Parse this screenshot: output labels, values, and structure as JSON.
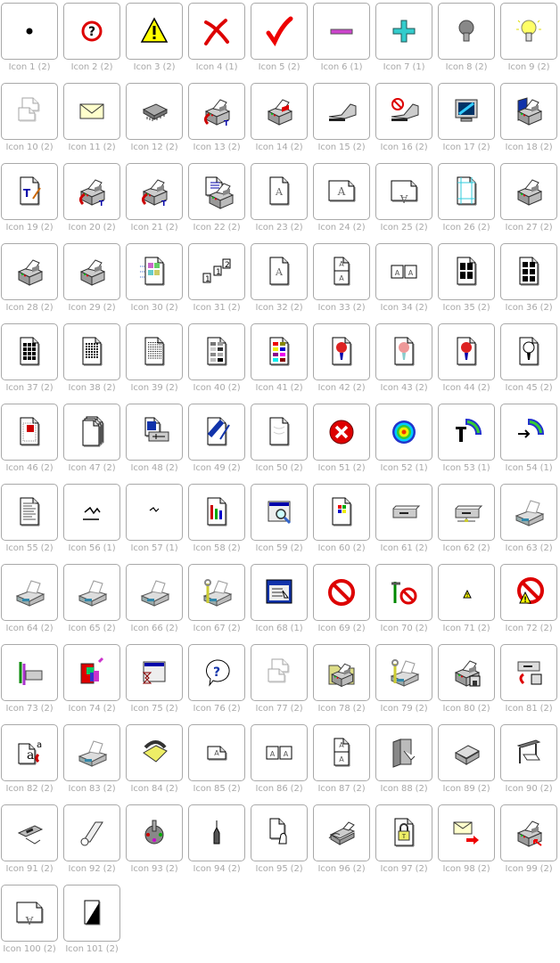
{
  "gallery": {
    "columns": 9,
    "icons": [
      {
        "label": "Icon 1 (2)",
        "name": "dot-icon",
        "glyph": "dot"
      },
      {
        "label": "Icon 2 (2)",
        "name": "question-circle-icon",
        "glyph": "question-red"
      },
      {
        "label": "Icon 3 (2)",
        "name": "warning-icon",
        "glyph": "warning"
      },
      {
        "label": "Icon 4 (1)",
        "name": "red-x-icon",
        "glyph": "redx"
      },
      {
        "label": "Icon 5 (2)",
        "name": "checkmark-icon",
        "glyph": "check"
      },
      {
        "label": "Icon 6 (1)",
        "name": "minus-icon",
        "glyph": "minus"
      },
      {
        "label": "Icon 7 (1)",
        "name": "plus-icon",
        "glyph": "plus"
      },
      {
        "label": "Icon 8 (2)",
        "name": "lightbulb-off-icon",
        "glyph": "bulb-off"
      },
      {
        "label": "Icon 9 (2)",
        "name": "lightbulb-on-icon",
        "glyph": "bulb-on"
      },
      {
        "label": "Icon 10 (2)",
        "name": "page-orientation-icon",
        "glyph": "ghost-doc"
      },
      {
        "label": "Icon 11 (2)",
        "name": "envelope-icon",
        "glyph": "envelope"
      },
      {
        "label": "Icon 12 (2)",
        "name": "memory-chip-icon",
        "glyph": "chip"
      },
      {
        "label": "Icon 13 (2)",
        "name": "printer-font-icon",
        "glyph": "printer-arrow"
      },
      {
        "label": "Icon 14 (2)",
        "name": "printer-cartridge-icon",
        "glyph": "printer-red"
      },
      {
        "label": "Icon 15 (2)",
        "name": "stapler-icon",
        "glyph": "stapler"
      },
      {
        "label": "Icon 16 (2)",
        "name": "stapler-disabled-icon",
        "glyph": "stapler-no"
      },
      {
        "label": "Icon 17 (2)",
        "name": "monitor-icon",
        "glyph": "monitor"
      },
      {
        "label": "Icon 18 (2)",
        "name": "printer-monitor-icon",
        "glyph": "printer-blue"
      },
      {
        "label": "Icon 19 (2)",
        "name": "truetype-edit-icon",
        "glyph": "tt-doc"
      },
      {
        "label": "Icon 20 (2)",
        "name": "printer-truetype-icon",
        "glyph": "printer-arrow"
      },
      {
        "label": "Icon 21 (2)",
        "name": "printer-truetype-outline-icon",
        "glyph": "printer-arrow"
      },
      {
        "label": "Icon 22 (2)",
        "name": "printer-document-icon",
        "glyph": "printer-doc"
      },
      {
        "label": "Icon 23 (2)",
        "name": "portrait-page-icon",
        "glyph": "page-a"
      },
      {
        "label": "Icon 24 (2)",
        "name": "landscape-page-icon",
        "glyph": "page-a-wide"
      },
      {
        "label": "Icon 25 (2)",
        "name": "rotated-page-icon",
        "glyph": "page-a-flip"
      },
      {
        "label": "Icon 26 (2)",
        "name": "page-margins-icon",
        "glyph": "page-margins"
      },
      {
        "label": "Icon 27 (2)",
        "name": "printer-stack-icon",
        "glyph": "printer"
      },
      {
        "label": "Icon 28 (2)",
        "name": "printer-tray-icon",
        "glyph": "printer"
      },
      {
        "label": "Icon 29 (2)",
        "name": "printer-tray-small-icon",
        "glyph": "printer"
      },
      {
        "label": "Icon 30 (2)",
        "name": "color-page-icon",
        "glyph": "page-color"
      },
      {
        "label": "Icon 31 (2)",
        "name": "collate-icon",
        "glyph": "collate"
      },
      {
        "label": "Icon 32 (2)",
        "name": "single-page-icon",
        "glyph": "page-a"
      },
      {
        "label": "Icon 33 (2)",
        "name": "two-pages-vertical-icon",
        "glyph": "pages-vertical"
      },
      {
        "label": "Icon 34 (2)",
        "name": "two-pages-book-icon",
        "glyph": "pages-book"
      },
      {
        "label": "Icon 35 (2)",
        "name": "four-up-page-icon",
        "glyph": "page-grid-4"
      },
      {
        "label": "Icon 36 (2)",
        "name": "six-up-page-icon",
        "glyph": "page-grid-6"
      },
      {
        "label": "Icon 37 (2)",
        "name": "nine-up-page-icon",
        "glyph": "page-grid-9"
      },
      {
        "label": "Icon 38 (2)",
        "name": "fine-dither-page-icon",
        "glyph": "page-grid-dots"
      },
      {
        "label": "Icon 39 (2)",
        "name": "finer-dither-page-icon",
        "glyph": "page-grid-fine"
      },
      {
        "label": "Icon 40 (2)",
        "name": "grayscale-page-icon",
        "glyph": "page-gray"
      },
      {
        "label": "Icon 41 (2)",
        "name": "color-swatches-page-icon",
        "glyph": "page-swatches"
      },
      {
        "label": "Icon 42 (2)",
        "name": "flower-page-icon",
        "glyph": "page-flower"
      },
      {
        "label": "Icon 43 (2)",
        "name": "flower-light-page-icon",
        "glyph": "page-flower-light"
      },
      {
        "label": "Icon 44 (2)",
        "name": "flower-vivid-page-icon",
        "glyph": "page-flower"
      },
      {
        "label": "Icon 45 (2)",
        "name": "flower-bw-page-icon",
        "glyph": "page-flower-bw"
      },
      {
        "label": "Icon 46 (2)",
        "name": "page-resize-icon",
        "glyph": "page-resize"
      },
      {
        "label": "Icon 47 (2)",
        "name": "page-stack-icon",
        "glyph": "page-stack"
      },
      {
        "label": "Icon 48 (2)",
        "name": "page-slider-icon",
        "glyph": "page-slider"
      },
      {
        "label": "Icon 49 (2)",
        "name": "page-pen-icon",
        "glyph": "page-pen"
      },
      {
        "label": "Icon 50 (2)",
        "name": "watermark-page-icon",
        "glyph": "page-blank"
      },
      {
        "label": "Icon 51 (2)",
        "name": "error-circle-icon",
        "glyph": "error"
      },
      {
        "label": "Icon 52 (1)",
        "name": "target-spectrum-icon",
        "glyph": "target"
      },
      {
        "label": "Icon 53 (1)",
        "name": "spectrum-tool-icon",
        "glyph": "spectrum-t"
      },
      {
        "label": "Icon 54 (1)",
        "name": "spectrum-arrow-icon",
        "glyph": "spectrum-arrow"
      },
      {
        "label": "Icon 55 (2)",
        "name": "text-document-icon",
        "glyph": "page-text"
      },
      {
        "label": "Icon 56 (1)",
        "name": "plotter-pen-icon",
        "glyph": "scribble"
      },
      {
        "label": "Icon 57 (1)",
        "name": "plotter-small-icon",
        "glyph": "scribble-small"
      },
      {
        "label": "Icon 58 (2)",
        "name": "chart-document-icon",
        "glyph": "page-chart"
      },
      {
        "label": "Icon 59 (2)",
        "name": "window-search-icon",
        "glyph": "window-search"
      },
      {
        "label": "Icon 60 (2)",
        "name": "windows-document-icon",
        "glyph": "page-windows"
      },
      {
        "label": "Icon 61 (2)",
        "name": "drive-icon",
        "glyph": "drive"
      },
      {
        "label": "Icon 62 (2)",
        "name": "network-drive-icon",
        "glyph": "net-drive"
      },
      {
        "label": "Icon 63 (2)",
        "name": "inkjet-printer-icon",
        "glyph": "inkjet"
      },
      {
        "label": "Icon 64 (2)",
        "name": "inkjet-printer-2-icon",
        "glyph": "inkjet"
      },
      {
        "label": "Icon 65 (2)",
        "name": "inkjet-printer-3-icon",
        "glyph": "inkjet"
      },
      {
        "label": "Icon 66 (2)",
        "name": "inkjet-printer-4-icon",
        "glyph": "inkjet"
      },
      {
        "label": "Icon 67 (2)",
        "name": "printer-wrench-icon",
        "glyph": "inkjet-wrench"
      },
      {
        "label": "Icon 68 (1)",
        "name": "window-list-icon",
        "glyph": "window-list"
      },
      {
        "label": "Icon 69 (2)",
        "name": "prohibited-icon",
        "glyph": "no"
      },
      {
        "label": "Icon 70 (2)",
        "name": "tools-prohibited-icon",
        "glyph": "tools-no"
      },
      {
        "label": "Icon 71 (2)",
        "name": "small-warning-icon",
        "glyph": "warning-small"
      },
      {
        "label": "Icon 72 (2)",
        "name": "prohibited-warning-icon",
        "glyph": "no-warning"
      },
      {
        "label": "Icon 73 (2)",
        "name": "tools-drive-icon",
        "glyph": "tools-drive"
      },
      {
        "label": "Icon 74 (2)",
        "name": "color-books-icon",
        "glyph": "books"
      },
      {
        "label": "Icon 75 (2)",
        "name": "window-hourglass-icon",
        "glyph": "window-hourglass"
      },
      {
        "label": "Icon 76 (2)",
        "name": "help-bubble-icon",
        "glyph": "help-bubble"
      },
      {
        "label": "Icon 77 (2)",
        "name": "page-orientation-2-icon",
        "glyph": "ghost-doc"
      },
      {
        "label": "Icon 78 (2)",
        "name": "printer-folder-icon",
        "glyph": "printer-folder"
      },
      {
        "label": "Icon 79 (2)",
        "name": "printer-wrench-2-icon",
        "glyph": "inkjet-wrench"
      },
      {
        "label": "Icon 80 (2)",
        "name": "printer-floppy-icon",
        "glyph": "printer-floppy"
      },
      {
        "label": "Icon 81 (2)",
        "name": "drive-floppy-icon",
        "glyph": "drive-floppy"
      },
      {
        "label": "Icon 82 (2)",
        "name": "font-substitute-icon",
        "glyph": "font-sub"
      },
      {
        "label": "Icon 83 (2)",
        "name": "inkjet-printer-5-icon",
        "glyph": "inkjet"
      },
      {
        "label": "Icon 84 (2)",
        "name": "telephone-icon",
        "glyph": "phone"
      },
      {
        "label": "Icon 85 (2)",
        "name": "landscape-page-small-icon",
        "glyph": "page-a-land"
      },
      {
        "label": "Icon 86 (2)",
        "name": "two-pages-book-2-icon",
        "glyph": "pages-book"
      },
      {
        "label": "Icon 87 (2)",
        "name": "two-pages-vertical-2-icon",
        "glyph": "pages-vertical"
      },
      {
        "label": "Icon 88 (2)",
        "name": "binder-icon",
        "glyph": "binder"
      },
      {
        "label": "Icon 89 (2)",
        "name": "paper-tray-icon",
        "glyph": "tray"
      },
      {
        "label": "Icon 90 (2)",
        "name": "plotter-icon",
        "glyph": "plotter"
      },
      {
        "label": "Icon 91 (2)",
        "name": "dot-matrix-printer-icon",
        "glyph": "dotmatrix"
      },
      {
        "label": "Icon 92 (2)",
        "name": "paper-roll-icon",
        "glyph": "roll"
      },
      {
        "label": "Icon 93 (2)",
        "name": "pen-carousel-icon",
        "glyph": "carousel"
      },
      {
        "label": "Icon 94 (2)",
        "name": "plotter-pen-tip-icon",
        "glyph": "pen"
      },
      {
        "label": "Icon 95 (2)",
        "name": "manual-feed-icon",
        "glyph": "hand-page"
      },
      {
        "label": "Icon 96 (2)",
        "name": "fax-icon",
        "glyph": "fax"
      },
      {
        "label": "Icon 97 (2)",
        "name": "locked-document-icon",
        "glyph": "page-lock"
      },
      {
        "label": "Icon 98 (2)",
        "name": "send-mail-icon",
        "glyph": "mail-send"
      },
      {
        "label": "Icon 99 (2)",
        "name": "printer-port-icon",
        "glyph": "printer-port"
      },
      {
        "label": "Icon 100 (2)",
        "name": "rotated-page-2-icon",
        "glyph": "page-a-flip"
      },
      {
        "label": "Icon 101 (2)",
        "name": "blank-page-icon",
        "glyph": "page-plain"
      }
    ]
  }
}
